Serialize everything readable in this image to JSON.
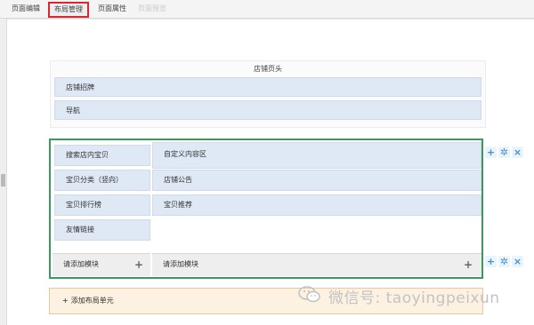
{
  "tabs": [
    {
      "label": "页面编辑",
      "state": "normal"
    },
    {
      "label": "布局管理",
      "state": "active"
    },
    {
      "label": "页面属性",
      "state": "normal"
    },
    {
      "label": "页面预览",
      "state": "disabled"
    }
  ],
  "header_section": {
    "title": "店铺页头",
    "rows": [
      "店铺招牌",
      "导航"
    ]
  },
  "body_section": {
    "left_column": [
      "搜索店内宝贝",
      "宝贝分类（竖向）",
      "宝贝排行榜",
      "友情链接"
    ],
    "right_column": [
      "自定义内容区",
      "店铺公告",
      "宝贝推荐"
    ],
    "left_add_label": "请添加模块",
    "right_add_label": "请添加模块"
  },
  "tools_icons": [
    "plus-icon",
    "gear-icon",
    "close-icon"
  ],
  "add_layout_unit_label": "添加布局单元",
  "watermark": {
    "text": "微信号: taoyingpeixun",
    "color": "#c3c3c3"
  },
  "colors": {
    "active_tab_border": "#d8282f",
    "selection_green": "#3a9a5c",
    "module_blue": "#dfe8f5",
    "layout_unit_bg": "#fdf2e1",
    "layout_unit_border": "#e7c9a0",
    "tool_icon": "#4a90c8"
  }
}
